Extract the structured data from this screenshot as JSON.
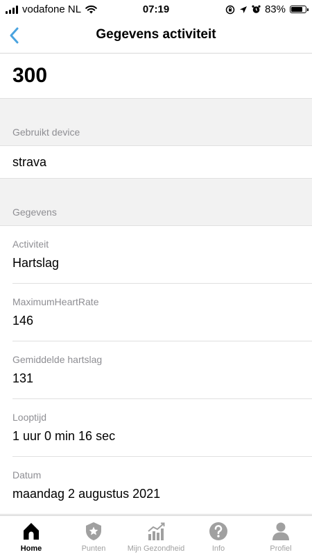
{
  "status_bar": {
    "carrier": "vodafone NL",
    "time": "07:19",
    "battery": "83%",
    "battery_level": 0.83
  },
  "nav": {
    "title": "Gegevens activiteit"
  },
  "main_value": "300",
  "device_section": {
    "header": "Gebruikt device",
    "value": "strava"
  },
  "details_section": {
    "header": "Gegevens",
    "rows": [
      {
        "label": "Activiteit",
        "value": "Hartslag"
      },
      {
        "label": "MaximumHeartRate",
        "value": "146"
      },
      {
        "label": "Gemiddelde hartslag",
        "value": "131"
      },
      {
        "label": "Looptijd",
        "value": "1 uur 0 min 16 sec"
      },
      {
        "label": "Datum",
        "value": "maandag 2 augustus 2021"
      }
    ]
  },
  "tabs": [
    {
      "label": "Home",
      "icon": "home-icon",
      "active": true
    },
    {
      "label": "Punten",
      "icon": "star-badge-icon",
      "active": false
    },
    {
      "label": "Mijn Gezondheid",
      "icon": "chart-icon",
      "active": false
    },
    {
      "label": "Info",
      "icon": "question-icon",
      "active": false
    },
    {
      "label": "Profiel",
      "icon": "person-icon",
      "active": false
    }
  ],
  "colors": {
    "accent": "#4aa3df",
    "tab_inactive": "#a0a0a0",
    "section_bg": "#f2f2f2"
  }
}
